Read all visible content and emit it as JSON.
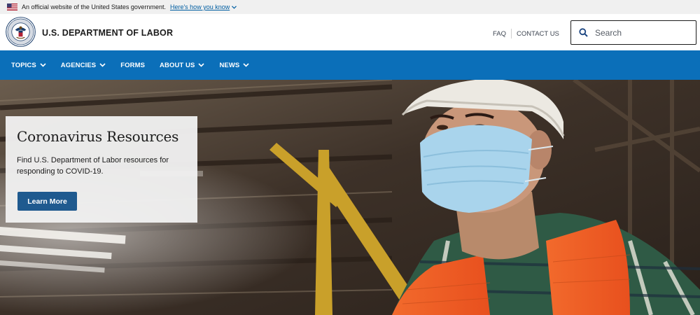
{
  "gov_banner": {
    "text": "An official website of the United States government.",
    "link": "Here's how you know"
  },
  "header": {
    "agency_name": "U.S. DEPARTMENT OF LABOR",
    "utility_links": [
      "FAQ",
      "CONTACT US"
    ],
    "search_placeholder": "Search"
  },
  "nav": {
    "items": [
      {
        "label": "TOPICS",
        "has_dropdown": true
      },
      {
        "label": "AGENCIES",
        "has_dropdown": true
      },
      {
        "label": "FORMS",
        "has_dropdown": false
      },
      {
        "label": "ABOUT US",
        "has_dropdown": true
      },
      {
        "label": "NEWS",
        "has_dropdown": true
      }
    ]
  },
  "hero": {
    "title": "Coronavirus Resources",
    "description": "Find U.S. Department of Labor resources for responding to COVID-19.",
    "button_label": "Learn More"
  },
  "colors": {
    "nav_bg": "#0b6fb9",
    "button_bg": "#1f5a8f",
    "banner_bg": "#f0f0f0",
    "link": "#005ea2"
  },
  "icons": [
    "us-flag-icon",
    "chevron-down-icon",
    "dol-seal-icon",
    "search-icon"
  ]
}
